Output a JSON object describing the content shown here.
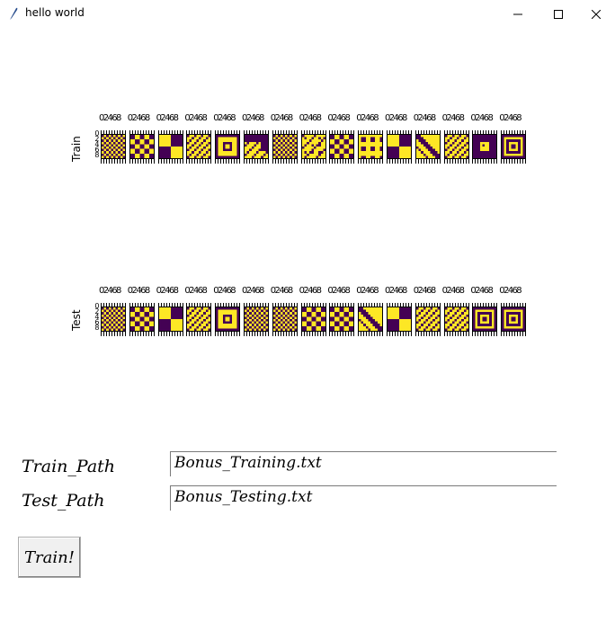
{
  "window": {
    "title": "hello world"
  },
  "controls": {
    "minimize": "minimize-icon",
    "maximize": "maximize-icon",
    "close": "close-icon"
  },
  "plots": {
    "train": {
      "ylabel": "Train",
      "xtick_text": "02468",
      "ytick_text": [
        "0",
        "2",
        "4",
        "6",
        "8"
      ],
      "patterns": [
        "checker-dense",
        "checker-coarse",
        "quad-split",
        "stripes-diag",
        "frame-square",
        "block-mixed",
        "checker-dense",
        "cross-dots",
        "checker-coarse",
        "dots-square",
        "quad-split",
        "diag-band",
        "stripes-diag",
        "frame-dark",
        "concentric"
      ]
    },
    "test": {
      "ylabel": "Test",
      "xtick_text": "02468",
      "ytick_text": [
        "0",
        "2",
        "4",
        "6",
        "8"
      ],
      "patterns": [
        "checker-dense",
        "checker-coarse",
        "quad-split",
        "stripes-diag",
        "frame-square",
        "checker-dense",
        "checker-dense",
        "checker-coarse",
        "checker-coarse",
        "diag-band",
        "quad-split",
        "stripes-diag",
        "stripes-diag",
        "concentric",
        "concentric"
      ]
    },
    "colors": {
      "dark": "#440154",
      "light": "#fde725"
    }
  },
  "form": {
    "train_label": "Train_Path",
    "test_label": "Test_Path",
    "train_value": "Bonus_Training.txt",
    "test_value": "Bonus_Testing.txt",
    "train_button": "Train!"
  }
}
